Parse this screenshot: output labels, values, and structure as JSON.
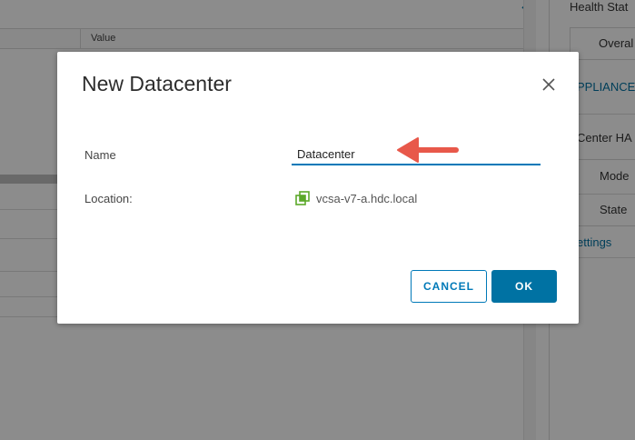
{
  "background": {
    "table_header_value": "Value",
    "right_panel": {
      "health_status": "Health Stat",
      "overall": "Overal",
      "appliance": "PPLIANCE",
      "center_ha": "Center HA",
      "mode": "Mode",
      "state": "State",
      "settings_link": "ettings"
    }
  },
  "dialog": {
    "title": "New Datacenter",
    "name_label": "Name",
    "name_value": "Datacenter",
    "location_label": "Location:",
    "location_value": "vcsa-v7-a.hdc.local",
    "cancel_label": "CANCEL",
    "ok_label": "OK"
  },
  "colors": {
    "accent": "#0072a3",
    "arrow": "#e8584a",
    "location_icon": "#5ba829"
  }
}
